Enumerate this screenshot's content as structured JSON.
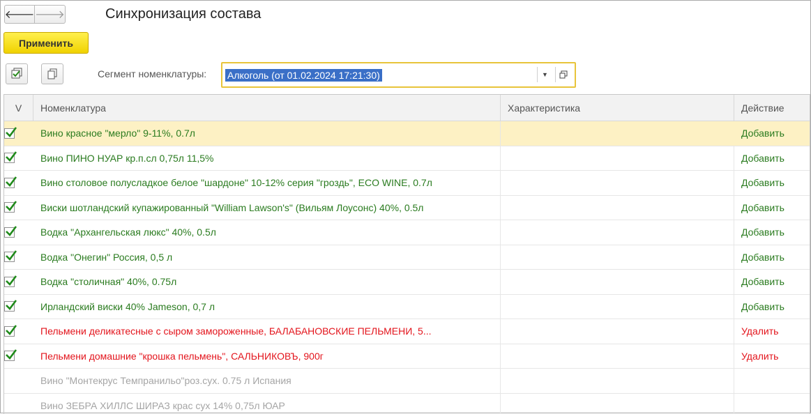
{
  "window": {
    "title": "Синхронизация состава"
  },
  "toolbar": {
    "apply_label": "Применить",
    "segment_label": "Сегмент номенклатуры:",
    "segment_value": "Алкоголь (от 01.02.2024 17:21:30)"
  },
  "table": {
    "columns": [
      "V",
      "Номенклатура",
      "Характеристика",
      "Действие"
    ],
    "rows": [
      {
        "checked": true,
        "name": "Вино красное \"мерло\" 9-11%, 0.7л",
        "characteristic": "",
        "action": "Добавить",
        "status": "add"
      },
      {
        "checked": true,
        "name": "Вино ПИНО НУАР кр.п.сл 0,75л 11,5%",
        "characteristic": "",
        "action": "Добавить",
        "status": "add"
      },
      {
        "checked": true,
        "name": "Вино столовое полусладкое белое \"шардоне\" 10-12% серия \"гроздь\", ECO WINE, 0.7л",
        "characteristic": "",
        "action": "Добавить",
        "status": "add"
      },
      {
        "checked": true,
        "name": "Виски шотландский купажированный \"William Lawson's\" (Вильям Лоусонс) 40%, 0.5л",
        "characteristic": "",
        "action": "Добавить",
        "status": "add"
      },
      {
        "checked": true,
        "name": "Водка \"Архангельская люкс\" 40%, 0.5л",
        "characteristic": "",
        "action": "Добавить",
        "status": "add"
      },
      {
        "checked": true,
        "name": "Водка \"Онегин\" Россия, 0,5 л",
        "characteristic": "",
        "action": "Добавить",
        "status": "add"
      },
      {
        "checked": true,
        "name": "Водка \"столичная\" 40%, 0.75л",
        "characteristic": "",
        "action": "Добавить",
        "status": "add"
      },
      {
        "checked": true,
        "name": "Ирландский виски 40% Jameson, 0,7 л",
        "characteristic": "",
        "action": "Добавить",
        "status": "add"
      },
      {
        "checked": true,
        "name": "Пельмени деликатесные с сыром замороженные, БАЛАБАНОВСКИЕ ПЕЛЬМЕНИ, 5...",
        "characteristic": "",
        "action": "Удалить",
        "status": "remove"
      },
      {
        "checked": true,
        "name": "Пельмени домашние \"крошка пельмень\", САЛЬНИКОВЪ, 900г",
        "characteristic": "",
        "action": "Удалить",
        "status": "remove"
      },
      {
        "checked": false,
        "name": "Вино \"Монтекрус Темпранильо\"роз.сух. 0.75 л Испания",
        "characteristic": "",
        "action": "",
        "status": "none"
      },
      {
        "checked": false,
        "name": "Вино ЗЕБРА ХИЛЛС ШИРАЗ крас сух 14% 0,75л ЮАР",
        "characteristic": "",
        "action": "",
        "status": "none"
      }
    ]
  },
  "colors": {
    "add": "#2a7b1f",
    "remove": "#e3141c",
    "none": "#a5a5a5",
    "selected_row": "#fdf1c4",
    "apply_button": "#f5d900",
    "segment_highlight": "#3a6fc7"
  },
  "icons": {
    "back": "arrow-left-icon",
    "forward": "arrow-right-icon",
    "check_all": "check-all-icon",
    "copy": "copy-icon",
    "dropdown": "chevron-down-icon",
    "open": "open-form-icon",
    "checkbox": "checkmark-icon"
  }
}
